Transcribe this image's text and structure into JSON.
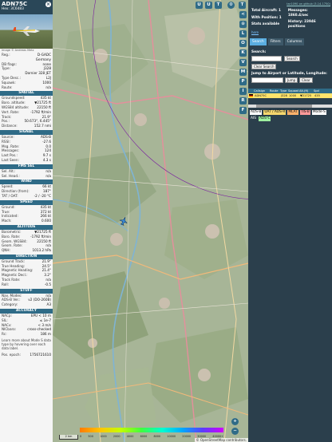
{
  "info": {
    "callsign": "ADN75C",
    "hex": "Hex: 3C6483",
    "photo_caption": "Image © Andreas Metz",
    "rows1": [
      {
        "k": "Reg.:",
        "v": "D-GADC"
      },
      {
        "k": "",
        "v": "Germany"
      },
      {
        "k": "DB flags:",
        "v": "none"
      },
      {
        "k": "Type:",
        "v": "J328"
      },
      {
        "k": "",
        "v": "Dornier 328 JET"
      },
      {
        "k": "Type Desc.:",
        "v": "L2J"
      },
      {
        "k": "Squawk:",
        "v": "1000"
      },
      {
        "k": "Route:",
        "v": "n/a"
      }
    ],
    "sec_spatial": "SPATIAL",
    "spatial": [
      {
        "k": "Groundspeed:",
        "v": "435 kt"
      },
      {
        "k": "Baro. altitude:",
        "v": "▼21725 ft"
      },
      {
        "k": "WGS84 altitude:",
        "v": "22150 ft"
      },
      {
        "k": "Vert. Rate:",
        "v": "-1792 ft/min"
      },
      {
        "k": "Track:",
        "v": "21.9°"
      },
      {
        "k": "Pos.:",
        "v": "50.673°, 6.445°"
      },
      {
        "k": "Distance:",
        "v": "152.7 nmi"
      }
    ],
    "sec_signal": "SIGNAL",
    "signal": [
      {
        "k": "Source:",
        "v": "ADS-B"
      },
      {
        "k": "RSSI:",
        "v": "-27.6"
      },
      {
        "k": "Msg. Rate:",
        "v": "0.0"
      },
      {
        "k": "Messages:",
        "v": "124"
      },
      {
        "k": "Last Pos.:",
        "v": "9.7 s"
      },
      {
        "k": "Last Seen:",
        "v": "4.3 s"
      }
    ],
    "sec_fms": "FMS SEL",
    "fms": [
      {
        "k": "Sel. Alt.:",
        "v": "n/a"
      },
      {
        "k": "Sel. Head.:",
        "v": "n/a"
      }
    ],
    "sec_wind": "WIND",
    "wind": [
      {
        "k": "Speed:",
        "v": "66 kt"
      },
      {
        "k": "Direction (from):",
        "v": "187°"
      },
      {
        "k": "TAT / OAT:",
        "v": "-2 / -20 °C"
      }
    ],
    "sec_speed": "SPEED",
    "speed": [
      {
        "k": "Ground:",
        "v": "435 kt"
      },
      {
        "k": "True:",
        "v": "372 kt"
      },
      {
        "k": "Indicated:",
        "v": "266 kt"
      },
      {
        "k": "Mach:",
        "v": "0.600"
      }
    ],
    "sec_alt": "ALTITUDE",
    "alt": [
      {
        "k": "Barometric:",
        "v": "▼21725 ft"
      },
      {
        "k": "Baro. Rate:",
        "v": "-1792 ft/min"
      },
      {
        "k": "Geom. WGS84:",
        "v": "22150 ft"
      },
      {
        "k": "Geom. Rate:",
        "v": "n/a"
      },
      {
        "k": "QNH:",
        "v": "1013.2 hPa"
      }
    ],
    "sec_dir": "DIRECTION",
    "dir": [
      {
        "k": "Ground Track:",
        "v": "21.9°"
      },
      {
        "k": "True Heading:",
        "v": "24.5°"
      },
      {
        "k": "Magnetic Heading:",
        "v": "21.4°"
      },
      {
        "k": "Magnetic Decl.:",
        "v": "3.2°"
      },
      {
        "k": "Track Rate:",
        "v": "n/a"
      },
      {
        "k": "Roll:",
        "v": "-0.5"
      }
    ],
    "sec_stuff": "STUFF",
    "stuff": [
      {
        "k": "Nav. Modes:",
        "v": "n/a"
      },
      {
        "k": "ADS-B Ver.:",
        "v": "v2 (DO-260B)"
      },
      {
        "k": "Category:",
        "v": "A3"
      }
    ],
    "sec_acc": "ACCURACY",
    "acc": [
      {
        "k": "NACp:",
        "v": "EPU < 10 m"
      },
      {
        "k": "SIL:",
        "v": "≤ 1e-7"
      },
      {
        "k": "NACv:",
        "v": "< 3 m/s"
      },
      {
        "k": "NICbaro:",
        "v": "cross-checked"
      },
      {
        "k": "Rc:",
        "v": "186 m"
      }
    ],
    "learn": "Learn more about Mode S data type by hovering over each data label.",
    "pos_epoch_k": "Pos. epoch:",
    "pos_epoch_v": "1756721610"
  },
  "map": {
    "top_buttons": [
      "U",
      "U",
      "T",
      "T"
    ],
    "side_buttons": [
      "<",
      "⊙",
      "L",
      "O",
      "K",
      "V",
      "M",
      "P",
      "I",
      "R",
      "F"
    ],
    "zoom_in": "+",
    "zoom_out": "−",
    "scale": "2 km",
    "attribution": "© OpenStreetMap contributors.",
    "alt_ticks": [
      "0",
      "500",
      "1000",
      "2000",
      "4000",
      "6000",
      "8000",
      "10000",
      "20000",
      "30000",
      "40000+"
    ]
  },
  "right": {
    "version": "tar1090 on github (3.14.1750)",
    "total_aircraft": "Total Aircraft: 1",
    "with_position": "With Position: 1",
    "stats_available": "Stats available",
    "stats_link": "here",
    "messages": "Messages: 1860.4/sec",
    "history": "History: 23946 positions",
    "tabs": [
      "Search",
      "Filters",
      "Columns"
    ],
    "search_label": "Search:",
    "search_btn": "Search",
    "clear_search": "Clear Search",
    "jump_label": "Jump to Airport or Latitude, Longitude:",
    "jump_btn": "Jump",
    "clear_btn": "Clear",
    "table_headers": [
      "",
      "Callsign",
      "Route",
      "Type",
      "Squawk",
      "Alt.(ft)",
      "Spd"
    ],
    "table_row": [
      "",
      "ADN75C",
      "",
      "J328",
      "1000",
      "▼21725",
      "435"
    ],
    "legend": [
      {
        "text": "ADS-B",
        "bg": "#ffffff",
        "fg": "#111111"
      },
      {
        "text": "UAT / ADS-R",
        "bg": "#f5d76e",
        "fg": "#111111"
      },
      {
        "text": "MLAT",
        "bg": "#ffb26b",
        "fg": "#111111"
      },
      {
        "text": "TIS-B",
        "bg": "#ff9a9a",
        "fg": "#111111"
      },
      {
        "text": "Mode-S",
        "bg": "#ffffff",
        "fg": "#111111"
      },
      {
        "text": "AIS",
        "bg": "#2b3f4c",
        "fg": "#ffffff"
      },
      {
        "text": "ADS-C",
        "bg": "#9ef0a0",
        "fg": "#111111"
      }
    ]
  }
}
